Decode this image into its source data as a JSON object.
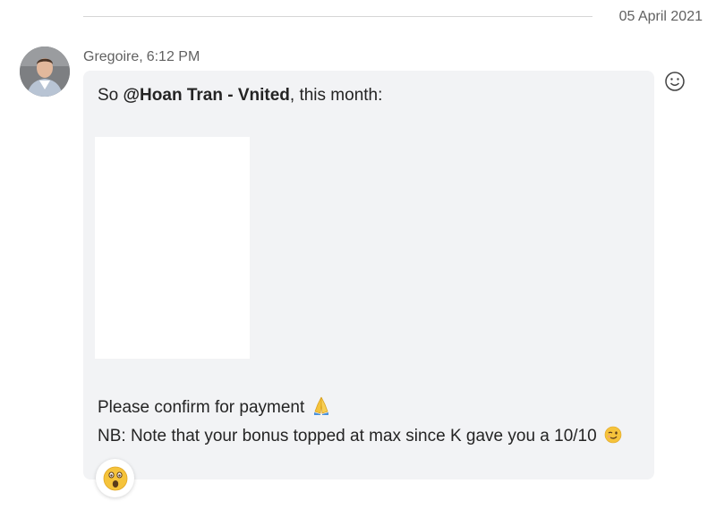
{
  "date_divider": {
    "date": "05 April 2021"
  },
  "message": {
    "sender": "Gregoire",
    "separator": ",",
    "time": "6:12 PM",
    "line1_prefix": "So ",
    "mention": "@Hoan Tran - Vnited",
    "line1_suffix": ", this month:",
    "line2": "Please confirm for payment",
    "line2_emoji": "folded-hands-emoji",
    "line3": "NB: Note that your bonus topped at max since K gave you a 10/10",
    "line3_emoji": "winking-face-emoji"
  },
  "actions": {
    "add_reaction_icon": "smiley-icon"
  },
  "reactions": [
    {
      "emoji": "surprised-face-emoji"
    }
  ],
  "colors": {
    "bubble": "#f2f3f5",
    "text": "#242424",
    "meta": "#616161",
    "emoji": "#f5c33b"
  }
}
